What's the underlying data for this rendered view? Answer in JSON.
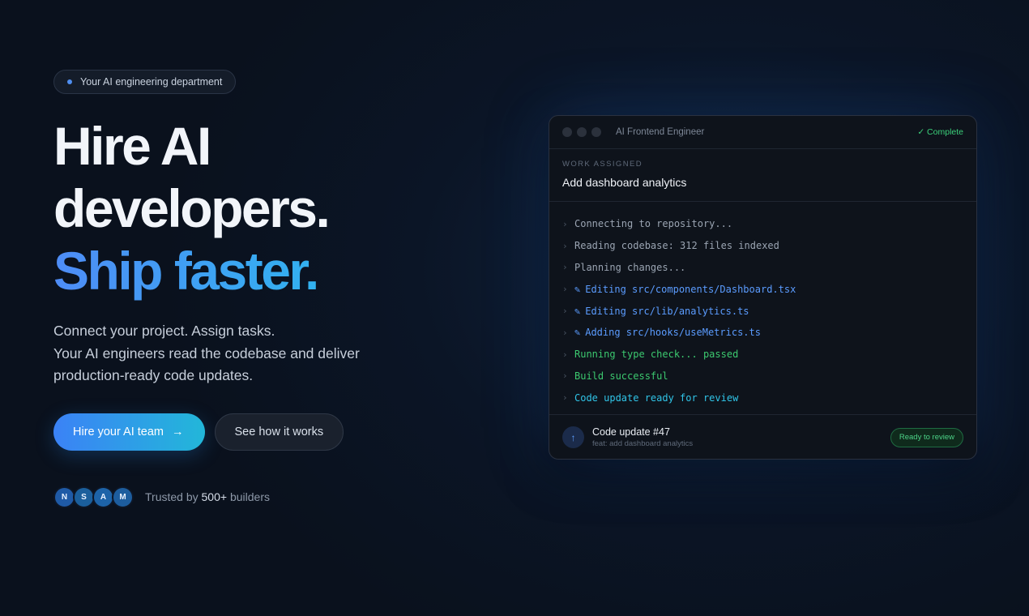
{
  "hero": {
    "badge": "Your AI engineering department",
    "headline": [
      "Hire AI",
      "developers.",
      "Ship faster."
    ],
    "subheadline": [
      "Connect your project. Assign tasks.",
      "Your AI engineers read the codebase and deliver",
      "production-ready code updates."
    ],
    "primary_cta": "Hire your AI team",
    "primary_cta_arrow": "→",
    "secondary_cta": "See how it works",
    "avatars": [
      "N",
      "S",
      "A",
      "M"
    ],
    "trust_prefix": "Trusted by",
    "trust_count": "500+",
    "trust_suffix": "builders"
  },
  "window": {
    "title": "AI Frontend Engineer",
    "status": "✓ Complete",
    "task_label": "WORK ASSIGNED",
    "task_title": "Add dashboard analytics",
    "log": [
      {
        "icon": "",
        "text": "Connecting to repository...",
        "kind": "info"
      },
      {
        "icon": "",
        "text": "Reading codebase: 312 files indexed",
        "kind": "info"
      },
      {
        "icon": "",
        "text": "Planning changes...",
        "kind": "info"
      },
      {
        "icon": "✎",
        "text": "Editing src/components/Dashboard.tsx",
        "kind": "edit"
      },
      {
        "icon": "✎",
        "text": "Editing src/lib/analytics.ts",
        "kind": "edit"
      },
      {
        "icon": "✎",
        "text": "Adding src/hooks/useMetrics.ts",
        "kind": "edit"
      },
      {
        "icon": "",
        "text": "Running type check... passed",
        "kind": "success"
      },
      {
        "icon": "",
        "text": "Build successful",
        "kind": "success"
      },
      {
        "icon": "",
        "text": "Code update ready for review",
        "kind": "ready"
      }
    ],
    "pr_icon": "↑",
    "pr_title": "Code update #47",
    "pr_subtitle": "feat: add dashboard analytics",
    "pr_badge": "Ready to review"
  },
  "colors": {
    "info": "#9aa4b2",
    "edit": "#5b9cff",
    "success": "#3cc96f",
    "ready": "#30c5e8",
    "avatars": [
      "#1f5aa6",
      "#1b5f9c",
      "#1d63a8",
      "#1d5d9e"
    ]
  }
}
